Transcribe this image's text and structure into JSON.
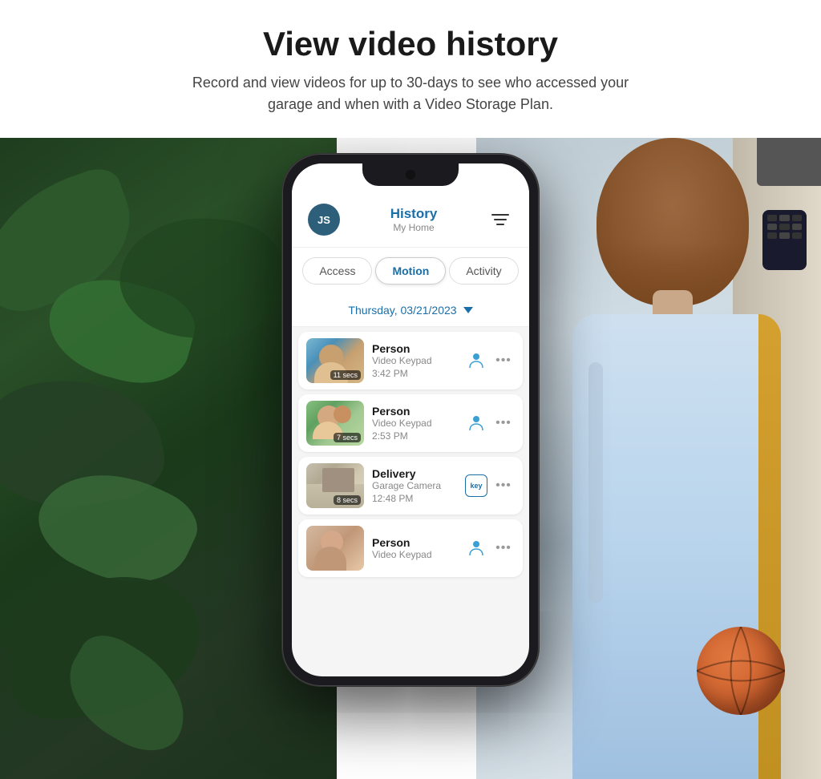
{
  "header": {
    "title": "View video history",
    "subtitle": "Record and view videos for up to 30-days to see who accessed your garage and when with a Video Storage Plan."
  },
  "app": {
    "user_initials": "JS",
    "screen_title": "History",
    "screen_subtitle": "My Home",
    "filter_label": "Filter",
    "tabs": [
      {
        "id": "access",
        "label": "Access",
        "active": false
      },
      {
        "id": "motion",
        "label": "Motion",
        "active": true
      },
      {
        "id": "activity",
        "label": "Activity",
        "active": false
      }
    ],
    "date": "Thursday, 03/21/2023",
    "history_items": [
      {
        "id": 1,
        "type": "Person",
        "source": "Video Keypad",
        "time": "3:42 PM",
        "duration": "11 secs",
        "icon": "person"
      },
      {
        "id": 2,
        "type": "Person",
        "source": "Video Keypad",
        "time": "2:53 PM",
        "duration": "7 secs",
        "icon": "person"
      },
      {
        "id": 3,
        "type": "Delivery",
        "source": "Garage Camera",
        "time": "12:48 PM",
        "duration": "8 secs",
        "icon": "key"
      },
      {
        "id": 4,
        "type": "Person",
        "source": "Video Keypad",
        "time": "",
        "duration": "",
        "icon": "person"
      }
    ]
  }
}
